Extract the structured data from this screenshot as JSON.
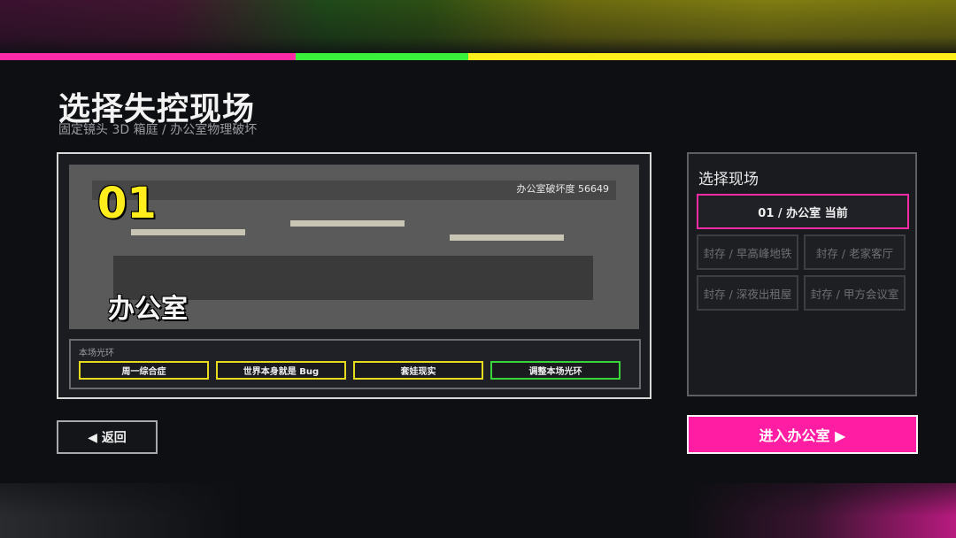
{
  "header": {
    "title": "选择失控现场",
    "subtitle": "固定镜头 3D 箱庭 / 办公室物理破坏"
  },
  "preview": {
    "scene_number": "01",
    "scene_name": "办公室",
    "destruction_label": "办公室破坏度 56649",
    "aura": {
      "label": "本场光环",
      "buttons": [
        "周一综合症",
        "世界本身就是 Bug",
        "套娃现实",
        "调整本场光环"
      ]
    }
  },
  "side_panel": {
    "title": "选择现场",
    "current": "01 / 办公室  当前",
    "locked": [
      "封存 / 早高峰地铁",
      "封存 / 老家客厅",
      "封存 / 深夜出租屋",
      "封存 / 甲方会议室"
    ]
  },
  "actions": {
    "enter_label": "进入办公室 ▶",
    "back_label": "◀ 返回"
  },
  "colors": {
    "accent_pink": "#ff1ea3",
    "accent_green": "#39f03a",
    "accent_yellow": "#ffee1c"
  }
}
